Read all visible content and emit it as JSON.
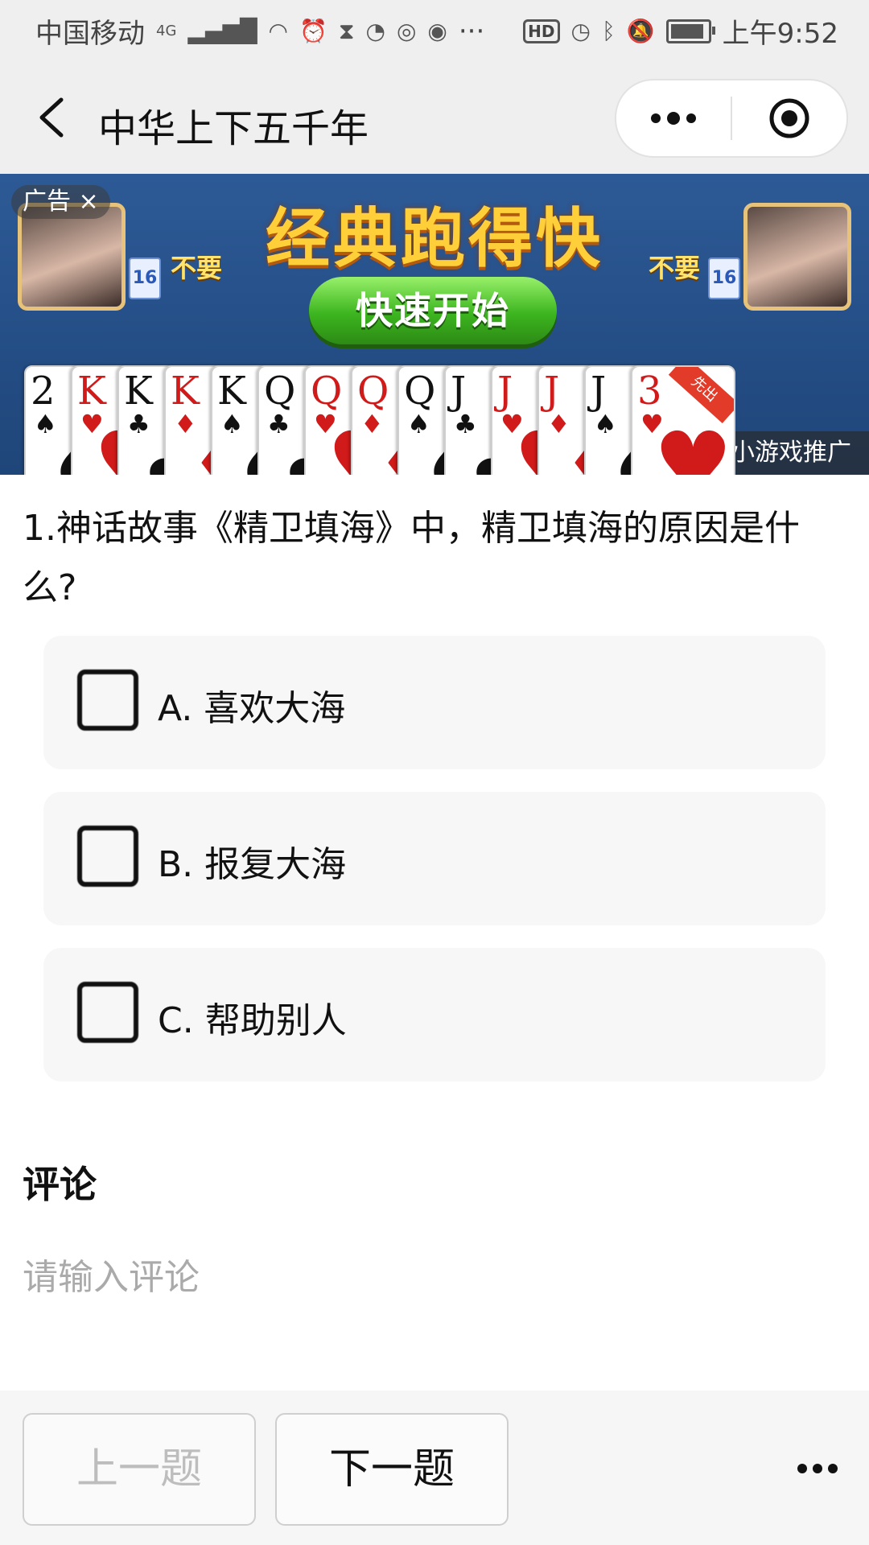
{
  "status_bar": {
    "carrier": "中国移动",
    "network": "4G",
    "ellipsis": "···",
    "hd": "HD",
    "time": "上午9:52"
  },
  "nav": {
    "title": "中华上下五千年"
  },
  "ad": {
    "tag": "广告",
    "title": "经典跑得快",
    "start_button": "快速开始",
    "left_badge": "16",
    "right_badge": "16",
    "left_pass": "不要",
    "right_pass": "不要",
    "corner_ribbon": "先出",
    "promo": "小游戏推广",
    "cards": [
      {
        "rank": "2",
        "suit": "♠",
        "color": "black"
      },
      {
        "rank": "K",
        "suit": "♥",
        "color": "red"
      },
      {
        "rank": "K",
        "suit": "♣",
        "color": "black"
      },
      {
        "rank": "K",
        "suit": "♦",
        "color": "red"
      },
      {
        "rank": "K",
        "suit": "♠",
        "color": "black"
      },
      {
        "rank": "Q",
        "suit": "♣",
        "color": "black"
      },
      {
        "rank": "Q",
        "suit": "♥",
        "color": "red"
      },
      {
        "rank": "Q",
        "suit": "♦",
        "color": "red"
      },
      {
        "rank": "Q",
        "suit": "♠",
        "color": "black"
      },
      {
        "rank": "J",
        "suit": "♣",
        "color": "black"
      },
      {
        "rank": "J",
        "suit": "♥",
        "color": "red"
      },
      {
        "rank": "J",
        "suit": "♦",
        "color": "red"
      },
      {
        "rank": "J",
        "suit": "♠",
        "color": "black"
      },
      {
        "rank": "3",
        "suit": "♥",
        "color": "red"
      }
    ]
  },
  "question": {
    "text": "1.神话故事《精卫填海》中，精卫填海的原因是什么?"
  },
  "options": [
    {
      "label": "A. 喜欢大海"
    },
    {
      "label": "B. 报复大海"
    },
    {
      "label": "C. 帮助别人"
    }
  ],
  "comment": {
    "title": "评论",
    "placeholder": "请输入评论"
  },
  "footer": {
    "prev": "上一题",
    "next": "下一题"
  }
}
